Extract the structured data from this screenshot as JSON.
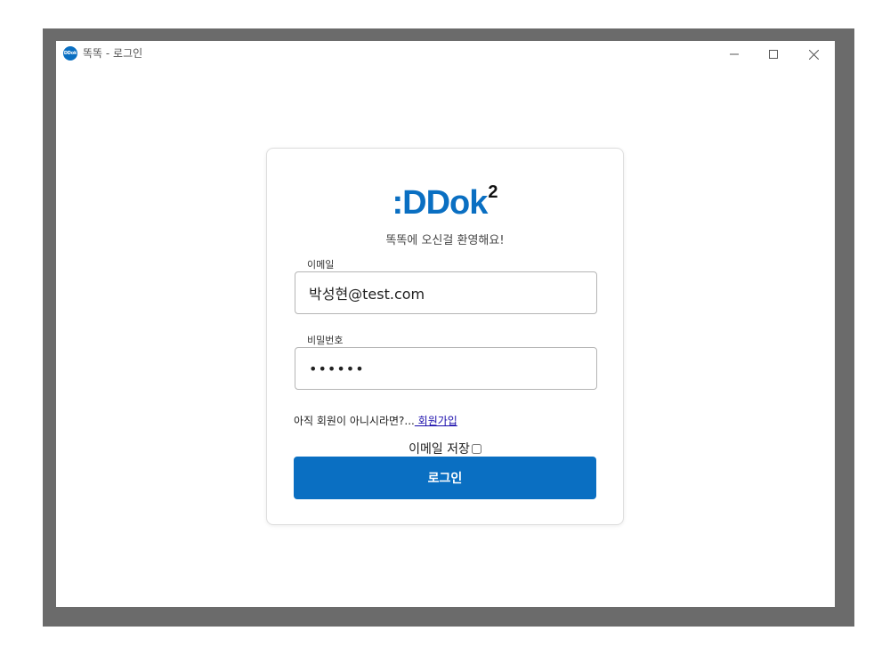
{
  "window": {
    "title": "똑똑 - 로그인",
    "app_icon_text": "DDok"
  },
  "login": {
    "logo_text": ":DDok",
    "logo_superscript": "2",
    "welcome": "똑똑에 오신걸 환영해요!",
    "email_label": "이메일",
    "email_value": "박성현@test.com",
    "password_label": "비밀번호",
    "password_value": "••••••",
    "signup_prompt": "아직 회원이 아니시라면?...",
    "signup_link": " 회원가입",
    "save_email_label": "이메일 저장",
    "save_email_checked": false,
    "login_button": "로그인"
  },
  "colors": {
    "brand": "#0a6fc2",
    "backdrop": "#6b6b6b",
    "link": "#1a0dab"
  },
  "icons": {
    "app": "ddok-logo-icon",
    "minimize": "minimize-icon",
    "maximize": "maximize-icon",
    "close": "close-icon"
  }
}
